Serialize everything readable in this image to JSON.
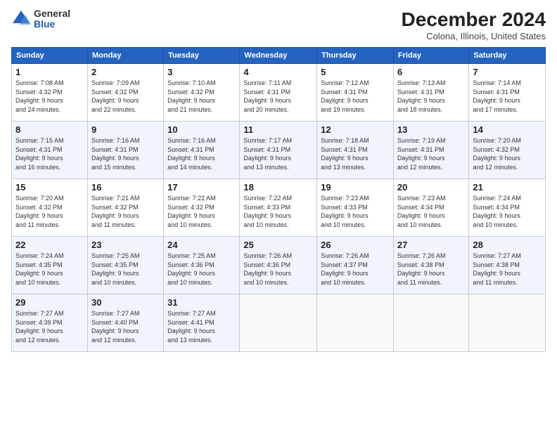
{
  "header": {
    "logo_general": "General",
    "logo_blue": "Blue",
    "month_title": "December 2024",
    "location": "Colona, Illinois, United States"
  },
  "days_of_week": [
    "Sunday",
    "Monday",
    "Tuesday",
    "Wednesday",
    "Thursday",
    "Friday",
    "Saturday"
  ],
  "weeks": [
    [
      {
        "day": "1",
        "sunrise": "7:08 AM",
        "sunset": "4:32 PM",
        "daylight": "9 hours and 24 minutes."
      },
      {
        "day": "2",
        "sunrise": "7:09 AM",
        "sunset": "4:32 PM",
        "daylight": "9 hours and 22 minutes."
      },
      {
        "day": "3",
        "sunrise": "7:10 AM",
        "sunset": "4:32 PM",
        "daylight": "9 hours and 21 minutes."
      },
      {
        "day": "4",
        "sunrise": "7:11 AM",
        "sunset": "4:31 PM",
        "daylight": "9 hours and 20 minutes."
      },
      {
        "day": "5",
        "sunrise": "7:12 AM",
        "sunset": "4:31 PM",
        "daylight": "9 hours and 19 minutes."
      },
      {
        "day": "6",
        "sunrise": "7:13 AM",
        "sunset": "4:31 PM",
        "daylight": "9 hours and 18 minutes."
      },
      {
        "day": "7",
        "sunrise": "7:14 AM",
        "sunset": "4:31 PM",
        "daylight": "9 hours and 17 minutes."
      }
    ],
    [
      {
        "day": "8",
        "sunrise": "7:15 AM",
        "sunset": "4:31 PM",
        "daylight": "9 hours and 16 minutes."
      },
      {
        "day": "9",
        "sunrise": "7:16 AM",
        "sunset": "4:31 PM",
        "daylight": "9 hours and 15 minutes."
      },
      {
        "day": "10",
        "sunrise": "7:16 AM",
        "sunset": "4:31 PM",
        "daylight": "9 hours and 14 minutes."
      },
      {
        "day": "11",
        "sunrise": "7:17 AM",
        "sunset": "4:31 PM",
        "daylight": "9 hours and 13 minutes."
      },
      {
        "day": "12",
        "sunrise": "7:18 AM",
        "sunset": "4:31 PM",
        "daylight": "9 hours and 13 minutes."
      },
      {
        "day": "13",
        "sunrise": "7:19 AM",
        "sunset": "4:31 PM",
        "daylight": "9 hours and 12 minutes."
      },
      {
        "day": "14",
        "sunrise": "7:20 AM",
        "sunset": "4:32 PM",
        "daylight": "9 hours and 12 minutes."
      }
    ],
    [
      {
        "day": "15",
        "sunrise": "7:20 AM",
        "sunset": "4:32 PM",
        "daylight": "9 hours and 11 minutes."
      },
      {
        "day": "16",
        "sunrise": "7:21 AM",
        "sunset": "4:32 PM",
        "daylight": "9 hours and 11 minutes."
      },
      {
        "day": "17",
        "sunrise": "7:22 AM",
        "sunset": "4:32 PM",
        "daylight": "9 hours and 10 minutes."
      },
      {
        "day": "18",
        "sunrise": "7:22 AM",
        "sunset": "4:33 PM",
        "daylight": "9 hours and 10 minutes."
      },
      {
        "day": "19",
        "sunrise": "7:23 AM",
        "sunset": "4:33 PM",
        "daylight": "9 hours and 10 minutes."
      },
      {
        "day": "20",
        "sunrise": "7:23 AM",
        "sunset": "4:34 PM",
        "daylight": "9 hours and 10 minutes."
      },
      {
        "day": "21",
        "sunrise": "7:24 AM",
        "sunset": "4:34 PM",
        "daylight": "9 hours and 10 minutes."
      }
    ],
    [
      {
        "day": "22",
        "sunrise": "7:24 AM",
        "sunset": "4:35 PM",
        "daylight": "9 hours and 10 minutes."
      },
      {
        "day": "23",
        "sunrise": "7:25 AM",
        "sunset": "4:35 PM",
        "daylight": "9 hours and 10 minutes."
      },
      {
        "day": "24",
        "sunrise": "7:25 AM",
        "sunset": "4:36 PM",
        "daylight": "9 hours and 10 minutes."
      },
      {
        "day": "25",
        "sunrise": "7:26 AM",
        "sunset": "4:36 PM",
        "daylight": "9 hours and 10 minutes."
      },
      {
        "day": "26",
        "sunrise": "7:26 AM",
        "sunset": "4:37 PM",
        "daylight": "9 hours and 10 minutes."
      },
      {
        "day": "27",
        "sunrise": "7:26 AM",
        "sunset": "4:38 PM",
        "daylight": "9 hours and 11 minutes."
      },
      {
        "day": "28",
        "sunrise": "7:27 AM",
        "sunset": "4:38 PM",
        "daylight": "9 hours and 11 minutes."
      }
    ],
    [
      {
        "day": "29",
        "sunrise": "7:27 AM",
        "sunset": "4:39 PM",
        "daylight": "9 hours and 12 minutes."
      },
      {
        "day": "30",
        "sunrise": "7:27 AM",
        "sunset": "4:40 PM",
        "daylight": "9 hours and 12 minutes."
      },
      {
        "day": "31",
        "sunrise": "7:27 AM",
        "sunset": "4:41 PM",
        "daylight": "9 hours and 13 minutes."
      },
      null,
      null,
      null,
      null
    ]
  ],
  "labels": {
    "sunrise": "Sunrise:",
    "sunset": "Sunset:",
    "daylight": "Daylight:"
  }
}
